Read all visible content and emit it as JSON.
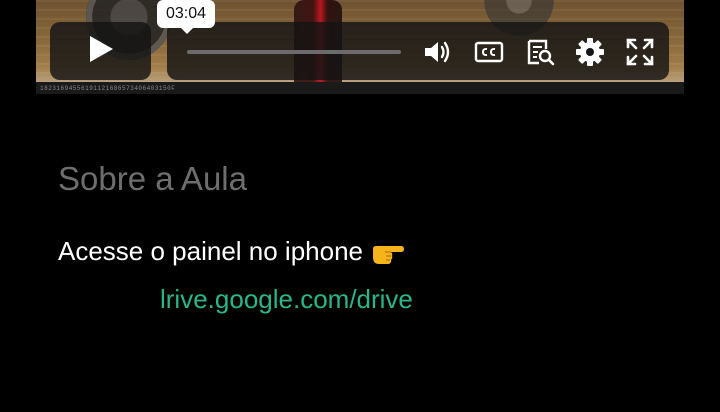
{
  "video": {
    "timestamp": "03:04",
    "progress": 0,
    "watermark": "18231694556191121686573406403150F"
  },
  "controls": {
    "play_icon": "play-icon",
    "volume_icon": "volume-icon",
    "captions_icon": "cc-icon",
    "transcript_icon": "transcript-search-icon",
    "settings_icon": "gear-icon",
    "fullscreen_icon": "fullscreen-icon"
  },
  "about": {
    "title": "Sobre a Aula",
    "description": "Acesse o painel no iphone",
    "emoji_icon": "pointing-right-hand-icon",
    "link_text": "lrive.google.com/drive"
  },
  "colors": {
    "link": "#2ab58a",
    "title": "#6e6e6e",
    "background": "#000000"
  }
}
